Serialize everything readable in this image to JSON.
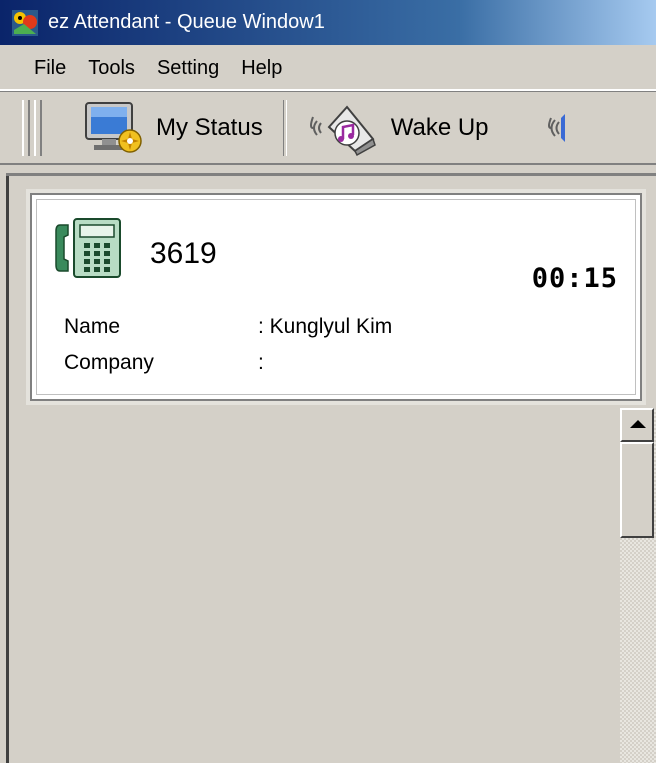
{
  "window": {
    "title": "ez Attendant - Queue Window1",
    "app_icon": "ez-attendant-logo-icon"
  },
  "menu": {
    "items": [
      {
        "label": "File"
      },
      {
        "label": "Tools"
      },
      {
        "label": "Setting"
      },
      {
        "label": "Help"
      }
    ]
  },
  "toolbar": {
    "my_status": {
      "label": "My Status",
      "icon": "monitor-status-icon"
    },
    "wake_up": {
      "label": "Wake Up",
      "icon": "music-bell-icon"
    },
    "partial": {
      "icon": "sound-waves-icon"
    }
  },
  "call": {
    "extension": "3619",
    "timer": "00:15",
    "phone_icon": "telephone-handset-icon",
    "fields": [
      {
        "label": "Name",
        "value": ": Kunglyul Kim"
      },
      {
        "label": "Company",
        "value": ":"
      }
    ]
  },
  "colors": {
    "title_bar_start": "#0a246a",
    "title_bar_end": "#a6caf0",
    "face": "#d4d0c8",
    "card_bg": "#ffffff",
    "phone_green": "#3a8a5c"
  }
}
